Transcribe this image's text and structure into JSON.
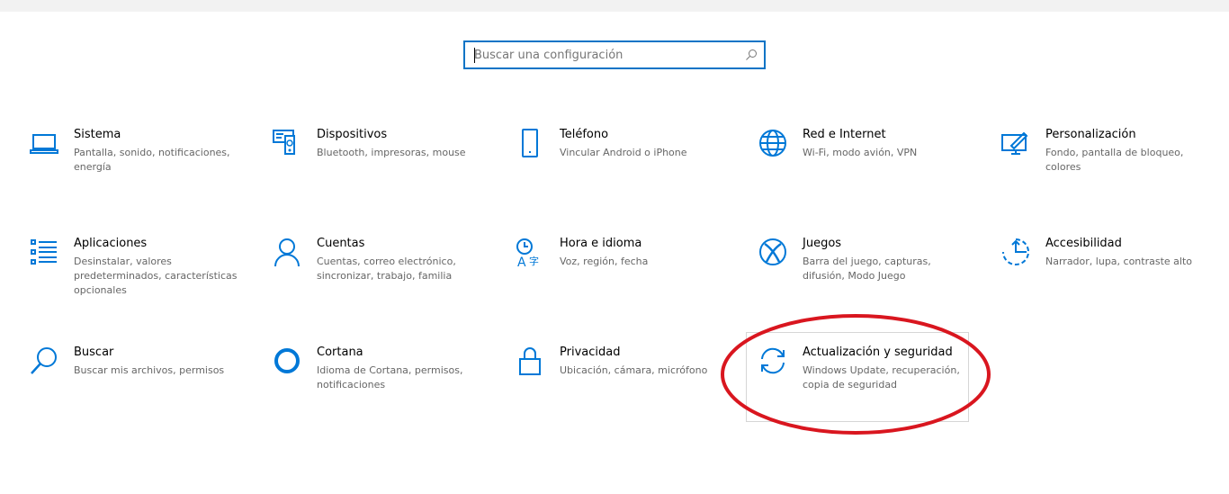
{
  "search": {
    "placeholder": "Buscar una configuración",
    "icon": "search-icon"
  },
  "accent": "#0078d7",
  "highlight_color": "#d9161f",
  "tiles": [
    {
      "title": "Sistema",
      "desc": "Pantalla, sonido, notificaciones, energía",
      "icon": "laptop-icon"
    },
    {
      "title": "Dispositivos",
      "desc": "Bluetooth, impresoras, mouse",
      "icon": "devices-icon"
    },
    {
      "title": "Teléfono",
      "desc": "Vincular Android o iPhone",
      "icon": "phone-icon"
    },
    {
      "title": "Red e Internet",
      "desc": "Wi-Fi, modo avión, VPN",
      "icon": "globe-icon"
    },
    {
      "title": "Personalización",
      "desc": "Fondo, pantalla de bloqueo, colores",
      "icon": "personalization-icon"
    },
    {
      "title": "Aplicaciones",
      "desc": "Desinstalar, valores predeterminados, características opcionales",
      "icon": "apps-list-icon"
    },
    {
      "title": "Cuentas",
      "desc": "Cuentas, correo electrónico, sincronizar, trabajo, familia",
      "icon": "person-icon"
    },
    {
      "title": "Hora e idioma",
      "desc": "Voz, región, fecha",
      "icon": "time-language-icon"
    },
    {
      "title": "Juegos",
      "desc": "Barra del juego, capturas, difusión, Modo Juego",
      "icon": "xbox-icon"
    },
    {
      "title": "Accesibilidad",
      "desc": "Narrador, lupa, contraste alto",
      "icon": "accessibility-icon"
    },
    {
      "title": "Buscar",
      "desc": "Buscar mis archivos, permisos",
      "icon": "search-icon"
    },
    {
      "title": "Cortana",
      "desc": "Idioma de Cortana, permisos, notificaciones",
      "icon": "cortana-icon"
    },
    {
      "title": "Privacidad",
      "desc": "Ubicación, cámara, micrófono",
      "icon": "lock-icon"
    },
    {
      "title": "Actualización y seguridad",
      "desc": "Windows Update, recuperación, copia de seguridad",
      "icon": "sync-icon",
      "highlighted": true
    }
  ]
}
